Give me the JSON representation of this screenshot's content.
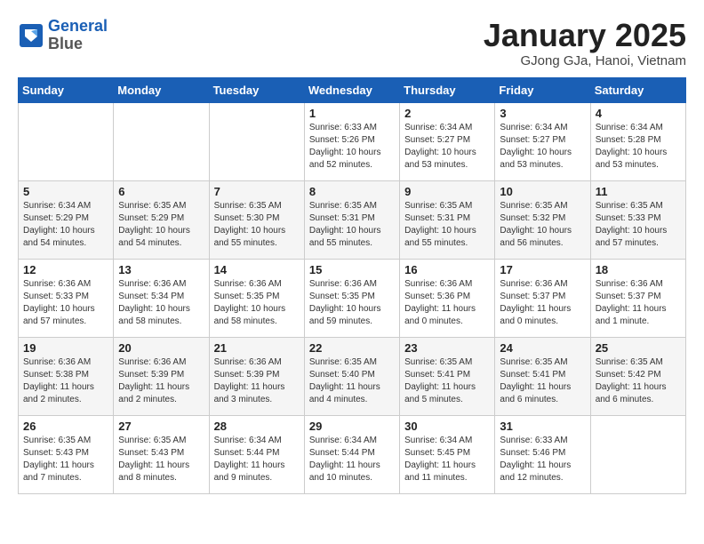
{
  "header": {
    "logo_line1": "General",
    "logo_line2": "Blue",
    "title": "January 2025",
    "subtitle": "GJong GJa, Hanoi, Vietnam"
  },
  "weekdays": [
    "Sunday",
    "Monday",
    "Tuesday",
    "Wednesday",
    "Thursday",
    "Friday",
    "Saturday"
  ],
  "weeks": [
    [
      {
        "day": "",
        "info": ""
      },
      {
        "day": "",
        "info": ""
      },
      {
        "day": "",
        "info": ""
      },
      {
        "day": "1",
        "info": "Sunrise: 6:33 AM\nSunset: 5:26 PM\nDaylight: 10 hours\nand 52 minutes."
      },
      {
        "day": "2",
        "info": "Sunrise: 6:34 AM\nSunset: 5:27 PM\nDaylight: 10 hours\nand 53 minutes."
      },
      {
        "day": "3",
        "info": "Sunrise: 6:34 AM\nSunset: 5:27 PM\nDaylight: 10 hours\nand 53 minutes."
      },
      {
        "day": "4",
        "info": "Sunrise: 6:34 AM\nSunset: 5:28 PM\nDaylight: 10 hours\nand 53 minutes."
      }
    ],
    [
      {
        "day": "5",
        "info": "Sunrise: 6:34 AM\nSunset: 5:29 PM\nDaylight: 10 hours\nand 54 minutes."
      },
      {
        "day": "6",
        "info": "Sunrise: 6:35 AM\nSunset: 5:29 PM\nDaylight: 10 hours\nand 54 minutes."
      },
      {
        "day": "7",
        "info": "Sunrise: 6:35 AM\nSunset: 5:30 PM\nDaylight: 10 hours\nand 55 minutes."
      },
      {
        "day": "8",
        "info": "Sunrise: 6:35 AM\nSunset: 5:31 PM\nDaylight: 10 hours\nand 55 minutes."
      },
      {
        "day": "9",
        "info": "Sunrise: 6:35 AM\nSunset: 5:31 PM\nDaylight: 10 hours\nand 55 minutes."
      },
      {
        "day": "10",
        "info": "Sunrise: 6:35 AM\nSunset: 5:32 PM\nDaylight: 10 hours\nand 56 minutes."
      },
      {
        "day": "11",
        "info": "Sunrise: 6:35 AM\nSunset: 5:33 PM\nDaylight: 10 hours\nand 57 minutes."
      }
    ],
    [
      {
        "day": "12",
        "info": "Sunrise: 6:36 AM\nSunset: 5:33 PM\nDaylight: 10 hours\nand 57 minutes."
      },
      {
        "day": "13",
        "info": "Sunrise: 6:36 AM\nSunset: 5:34 PM\nDaylight: 10 hours\nand 58 minutes."
      },
      {
        "day": "14",
        "info": "Sunrise: 6:36 AM\nSunset: 5:35 PM\nDaylight: 10 hours\nand 58 minutes."
      },
      {
        "day": "15",
        "info": "Sunrise: 6:36 AM\nSunset: 5:35 PM\nDaylight: 10 hours\nand 59 minutes."
      },
      {
        "day": "16",
        "info": "Sunrise: 6:36 AM\nSunset: 5:36 PM\nDaylight: 11 hours\nand 0 minutes."
      },
      {
        "day": "17",
        "info": "Sunrise: 6:36 AM\nSunset: 5:37 PM\nDaylight: 11 hours\nand 0 minutes."
      },
      {
        "day": "18",
        "info": "Sunrise: 6:36 AM\nSunset: 5:37 PM\nDaylight: 11 hours\nand 1 minute."
      }
    ],
    [
      {
        "day": "19",
        "info": "Sunrise: 6:36 AM\nSunset: 5:38 PM\nDaylight: 11 hours\nand 2 minutes."
      },
      {
        "day": "20",
        "info": "Sunrise: 6:36 AM\nSunset: 5:39 PM\nDaylight: 11 hours\nand 2 minutes."
      },
      {
        "day": "21",
        "info": "Sunrise: 6:36 AM\nSunset: 5:39 PM\nDaylight: 11 hours\nand 3 minutes."
      },
      {
        "day": "22",
        "info": "Sunrise: 6:35 AM\nSunset: 5:40 PM\nDaylight: 11 hours\nand 4 minutes."
      },
      {
        "day": "23",
        "info": "Sunrise: 6:35 AM\nSunset: 5:41 PM\nDaylight: 11 hours\nand 5 minutes."
      },
      {
        "day": "24",
        "info": "Sunrise: 6:35 AM\nSunset: 5:41 PM\nDaylight: 11 hours\nand 6 minutes."
      },
      {
        "day": "25",
        "info": "Sunrise: 6:35 AM\nSunset: 5:42 PM\nDaylight: 11 hours\nand 6 minutes."
      }
    ],
    [
      {
        "day": "26",
        "info": "Sunrise: 6:35 AM\nSunset: 5:43 PM\nDaylight: 11 hours\nand 7 minutes."
      },
      {
        "day": "27",
        "info": "Sunrise: 6:35 AM\nSunset: 5:43 PM\nDaylight: 11 hours\nand 8 minutes."
      },
      {
        "day": "28",
        "info": "Sunrise: 6:34 AM\nSunset: 5:44 PM\nDaylight: 11 hours\nand 9 minutes."
      },
      {
        "day": "29",
        "info": "Sunrise: 6:34 AM\nSunset: 5:44 PM\nDaylight: 11 hours\nand 10 minutes."
      },
      {
        "day": "30",
        "info": "Sunrise: 6:34 AM\nSunset: 5:45 PM\nDaylight: 11 hours\nand 11 minutes."
      },
      {
        "day": "31",
        "info": "Sunrise: 6:33 AM\nSunset: 5:46 PM\nDaylight: 11 hours\nand 12 minutes."
      },
      {
        "day": "",
        "info": ""
      }
    ]
  ]
}
